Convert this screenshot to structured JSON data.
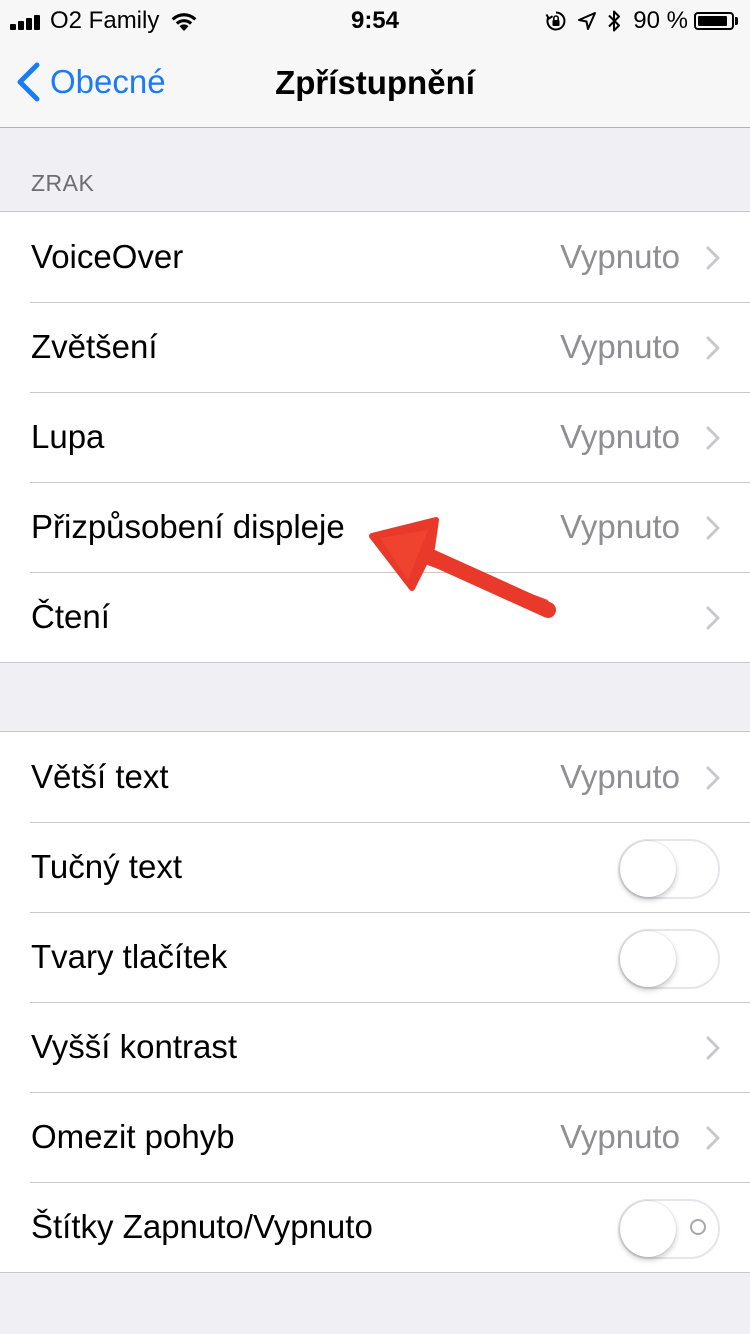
{
  "status_bar": {
    "carrier": "O2 Family",
    "time": "9:54",
    "battery_percent": "90 %",
    "battery_level": 0.9,
    "icons": [
      "signal-icon",
      "wifi-icon",
      "rotation-lock-icon",
      "location-icon",
      "bluetooth-icon",
      "battery-icon"
    ]
  },
  "nav": {
    "back_label": "Obecné",
    "title": "Zpřístupnění"
  },
  "section_header": "ZRAK",
  "vision_items": [
    {
      "label": "VoiceOver",
      "value": "Vypnuto"
    },
    {
      "label": "Zvětšení",
      "value": "Vypnuto"
    },
    {
      "label": "Lupa",
      "value": "Vypnuto"
    },
    {
      "label": "Přizpůsobení displeje",
      "value": "Vypnuto"
    },
    {
      "label": "Čtení"
    }
  ],
  "text_items": [
    {
      "label": "Větší text",
      "value": "Vypnuto"
    },
    {
      "label": "Tučný text",
      "toggle": "off"
    },
    {
      "label": "Tvary tlačítek",
      "toggle": "off"
    },
    {
      "label": "Vyšší kontrast"
    },
    {
      "label": "Omezit pohyb",
      "value": "Vypnuto"
    },
    {
      "label": "Štítky Zapnuto/Vypnuto",
      "toggle": "off"
    }
  ],
  "colors": {
    "accent": "#1a7cf5",
    "annotation": "#e8392a",
    "background": "#efeff4"
  }
}
